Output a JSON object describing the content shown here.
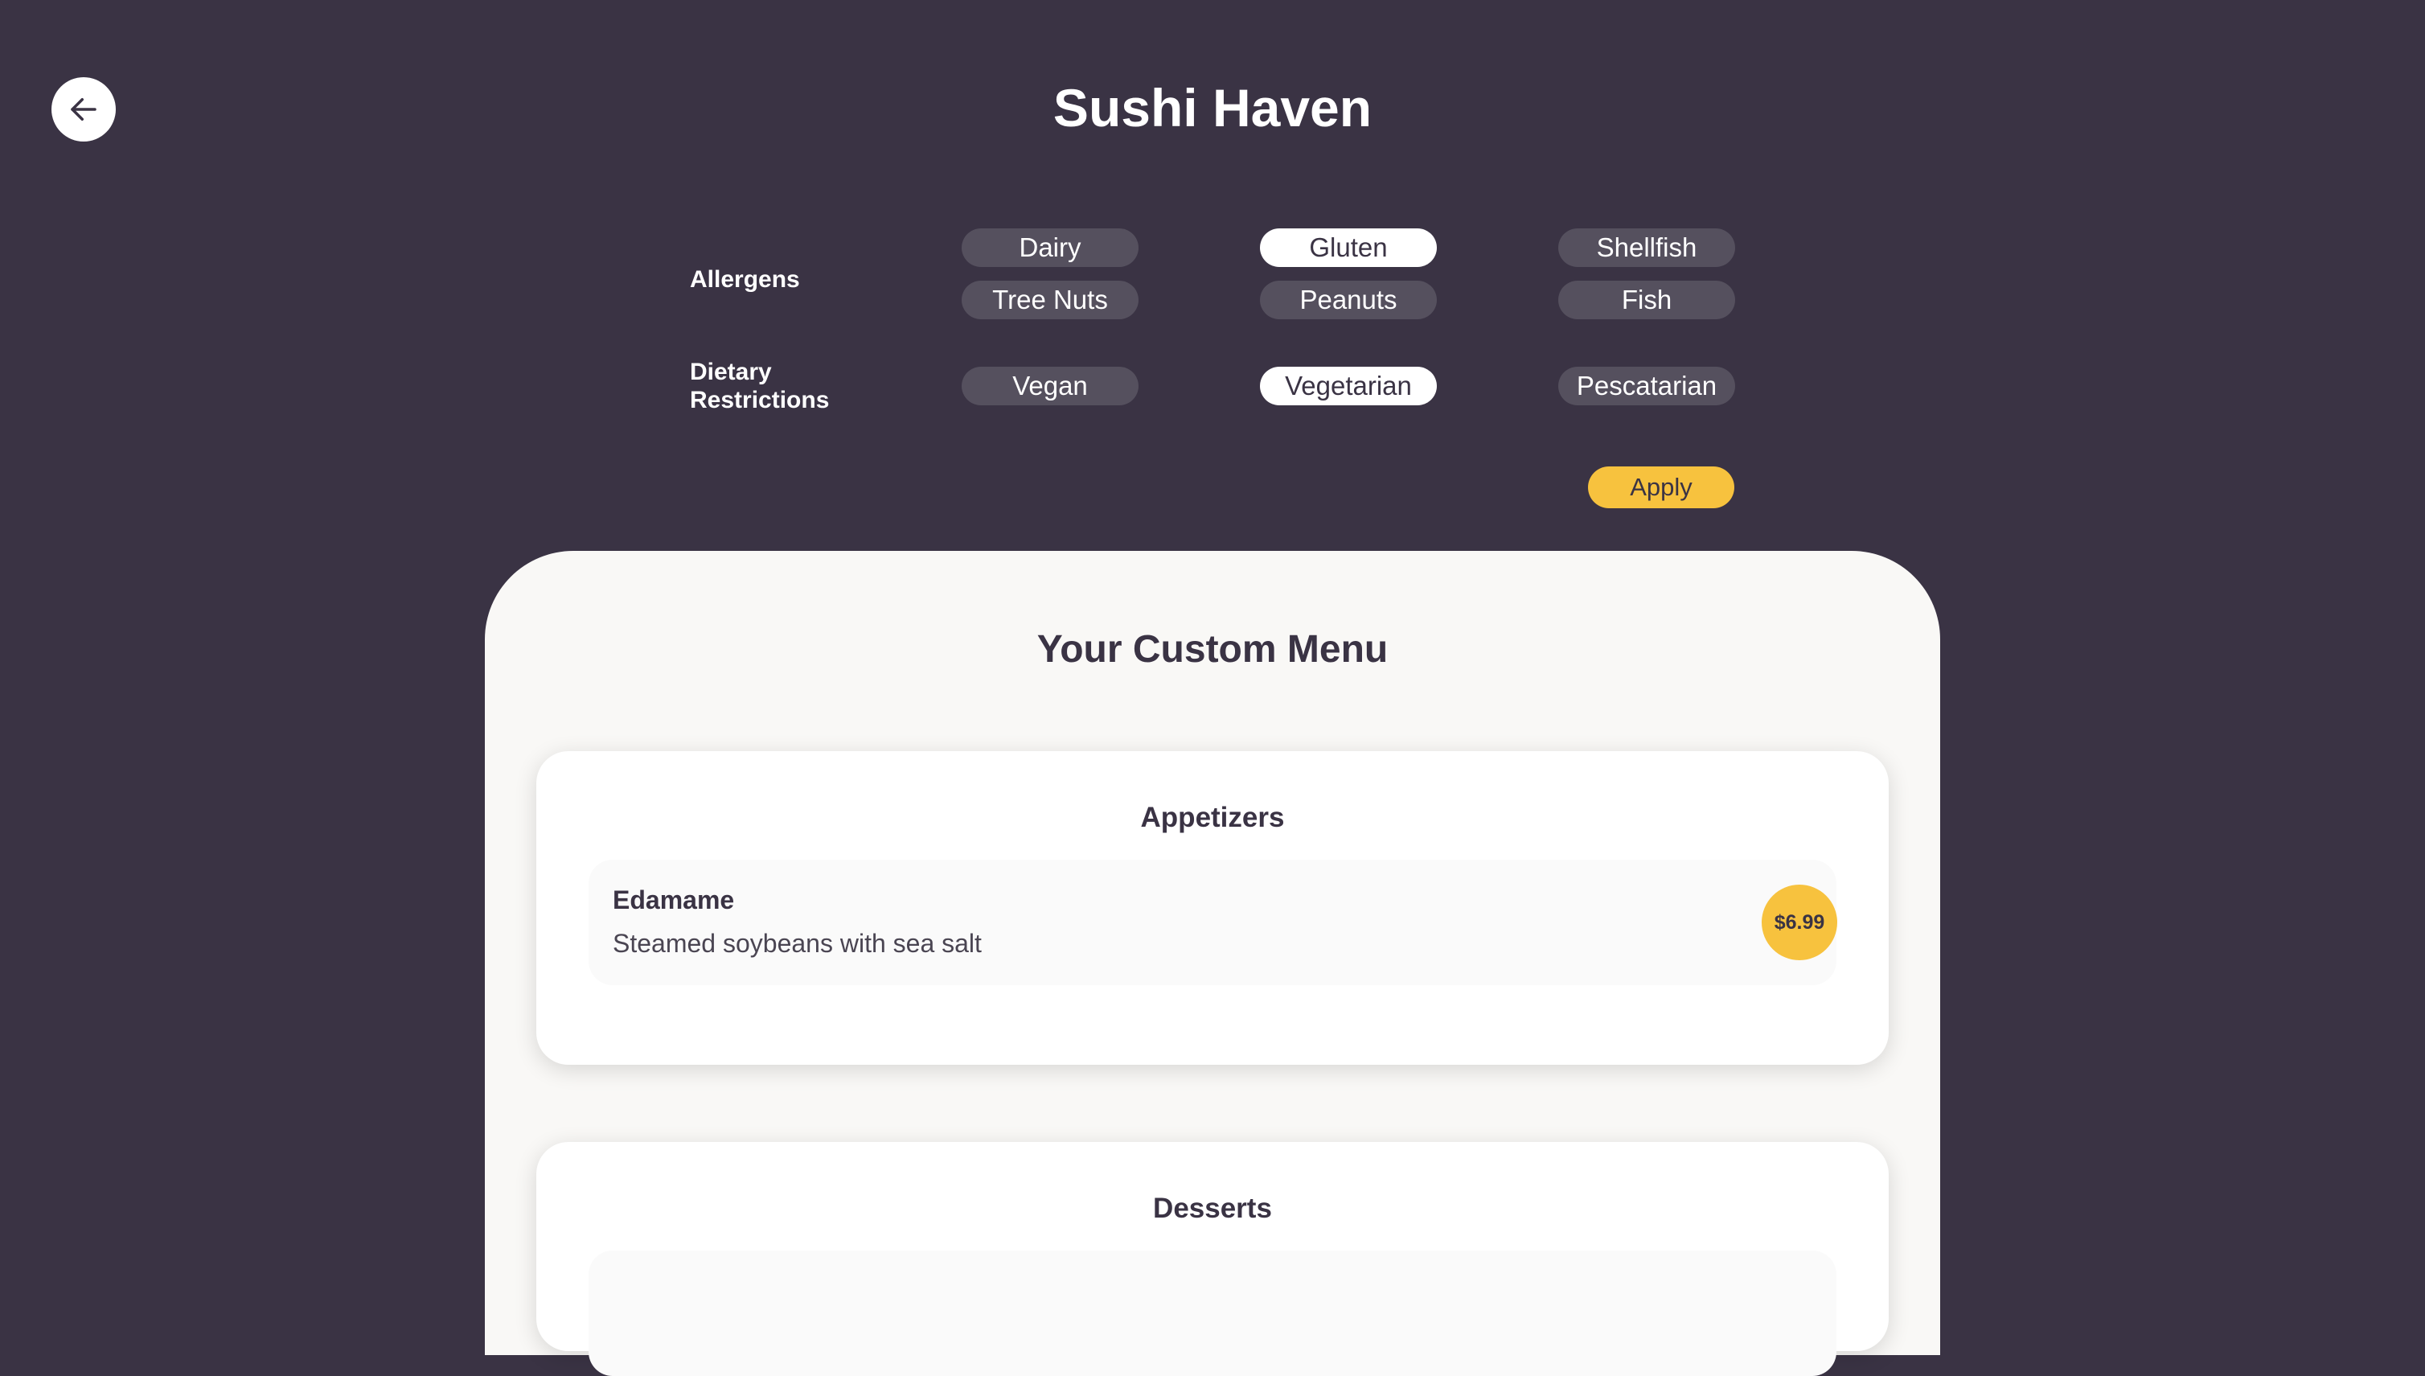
{
  "header": {
    "title": "Sushi Haven",
    "back_icon": "arrow-left-icon"
  },
  "filters": {
    "allergens": {
      "label": "Allergens",
      "options": [
        {
          "label": "Dairy",
          "selected": false
        },
        {
          "label": "Gluten",
          "selected": true
        },
        {
          "label": "Shellfish",
          "selected": false
        },
        {
          "label": "Tree Nuts",
          "selected": false
        },
        {
          "label": "Peanuts",
          "selected": false
        },
        {
          "label": "Fish",
          "selected": false
        }
      ]
    },
    "dietary": {
      "label_line1": "Dietary",
      "label_line2": "Restrictions",
      "options": [
        {
          "label": "Vegan",
          "selected": false
        },
        {
          "label": "Vegetarian",
          "selected": true
        },
        {
          "label": "Pescatarian",
          "selected": false
        }
      ]
    },
    "apply_label": "Apply"
  },
  "menu": {
    "title": "Your Custom Menu",
    "sections": [
      {
        "title": "Appetizers",
        "items": [
          {
            "name": "Edamame",
            "description": "Steamed soybeans with sea salt",
            "price": "$6.99"
          }
        ]
      },
      {
        "title": "Desserts",
        "items": []
      }
    ]
  },
  "colors": {
    "background": "#3a3344",
    "accent": "#f7c23e",
    "chip": "#55505e",
    "chip_selected": "#ffffff",
    "panel": "#f9f8f6"
  }
}
